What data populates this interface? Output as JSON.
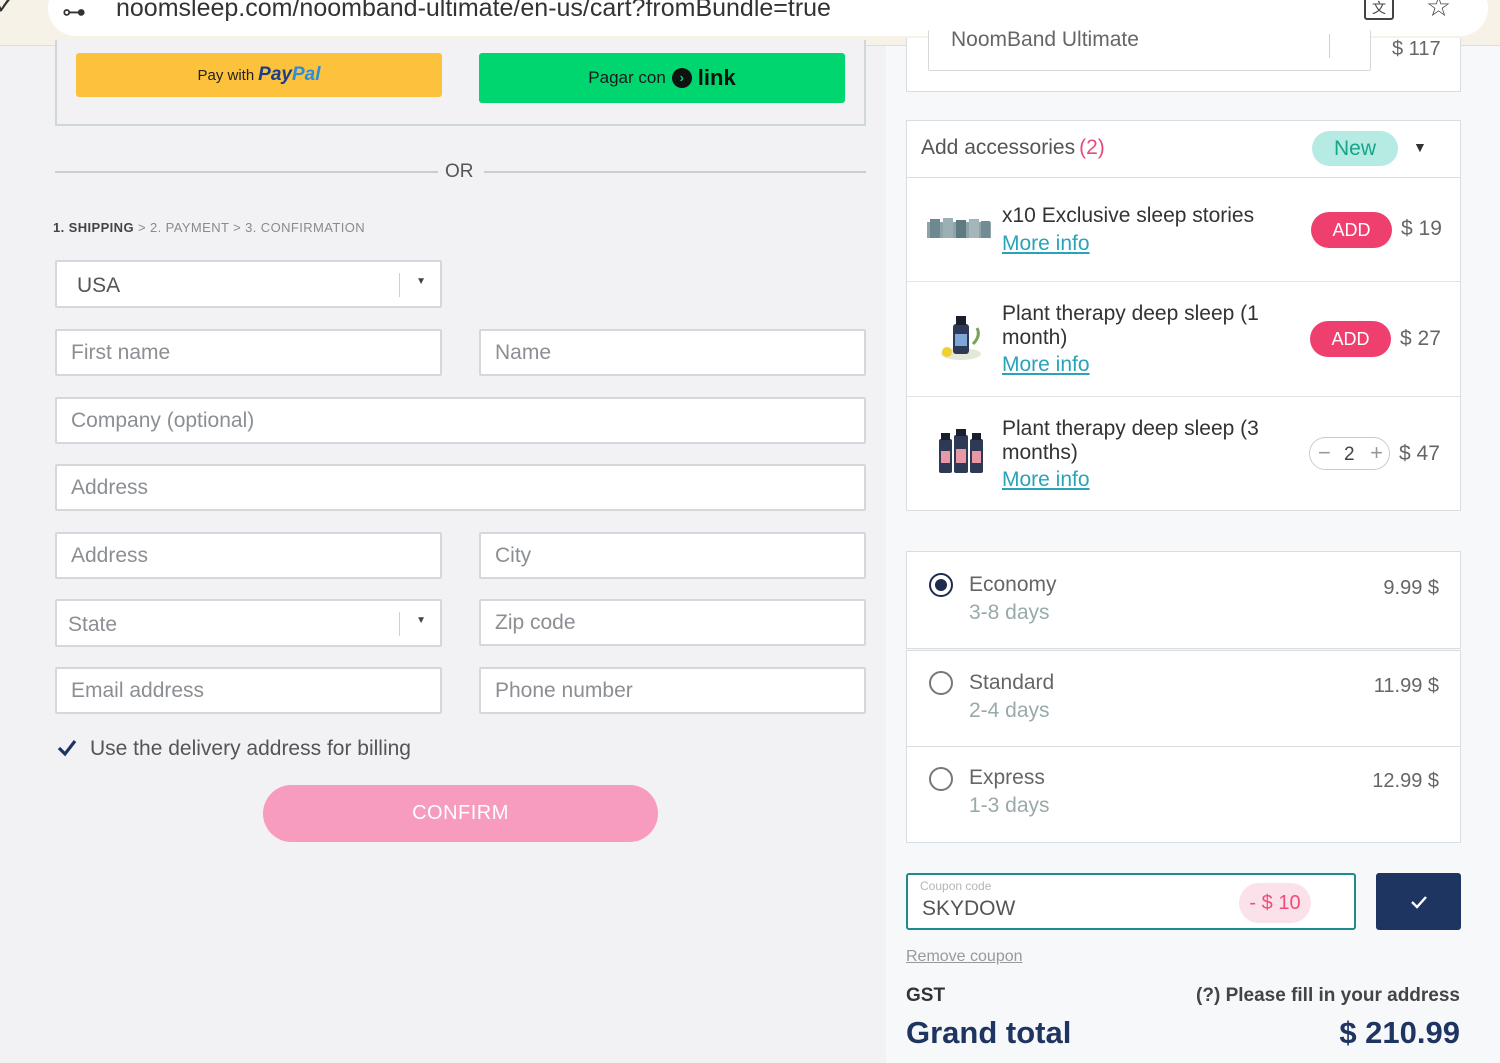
{
  "browser": {
    "url": "noomsleep.com/noomband-ultimate/en-us/cart?fromBundle=true"
  },
  "payment_buttons": {
    "paypal_prefix": "Pay with",
    "paypal_brand_1": "Pay",
    "paypal_brand_2": "Pal",
    "link_prefix": "Pagar con",
    "link_brand": "link"
  },
  "divider": {
    "or": "OR"
  },
  "steps": {
    "shipping": "1. SHIPPING",
    "rest": " > 2. PAYMENT > 3. CONFIRMATION"
  },
  "form": {
    "country": "USA",
    "first_name_ph": "First name",
    "last_name_ph": "Name",
    "company_ph": "Company (optional)",
    "address1_ph": "Address",
    "address2_ph": "Address",
    "city_ph": "City",
    "state_ph": "State",
    "zip_ph": "Zip code",
    "email_ph": "Email address",
    "phone_ph": "Phone number",
    "billing_same_label": "Use the delivery address for billing",
    "billing_same_checked": true,
    "confirm_label": "CONFIRM"
  },
  "cart": {
    "product_name": "NoomBand Ultimate",
    "product_price": "$ 117"
  },
  "accessories": {
    "title": "Add accessories",
    "count": "(2)",
    "badge": "New",
    "items": [
      {
        "name": "x10 Exclusive sleep stories",
        "more": "More info",
        "action": "ADD",
        "price": "$ 19"
      },
      {
        "name_line1": "Plant therapy deep sleep (1",
        "name_line2": "month)",
        "more": "More info",
        "action": "ADD",
        "price": "$ 27"
      },
      {
        "name_line1": "Plant therapy deep sleep (3",
        "name_line2": "months)",
        "more": "More info",
        "quantity": "2",
        "price": "$ 47"
      }
    ]
  },
  "shipping_options": [
    {
      "name": "Economy",
      "days": "3-8 days",
      "price": "9.99 $",
      "selected": true
    },
    {
      "name": "Standard",
      "days": "2-4 days",
      "price": "11.99 $",
      "selected": false
    },
    {
      "name": "Express",
      "days": "1-3 days",
      "price": "12.99 $",
      "selected": false
    }
  ],
  "coupon": {
    "label": "Coupon code",
    "code": "SKYDOW",
    "discount": "- $ 10",
    "remove_label": "Remove coupon"
  },
  "totals": {
    "gst_label": "GST",
    "gst_note": "(?) Please fill in your address",
    "grand_total_label": "Grand total",
    "grand_total": "$ 210.99"
  },
  "colors": {
    "paypal_yellow": "#fcc23b",
    "link_green": "#00d66f",
    "confirm_pink": "#f79cbf",
    "add_pink": "#ee3f6f",
    "navy": "#1f3561",
    "teal": "#1e8a8a"
  }
}
